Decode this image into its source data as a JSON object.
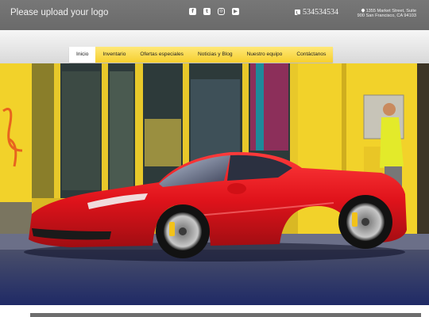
{
  "header": {
    "logo_text": "Please upload your logo",
    "social": [
      {
        "name": "facebook-icon",
        "glyph": "f"
      },
      {
        "name": "twitter-icon",
        "glyph": "t"
      },
      {
        "name": "instagram-icon",
        "glyph": "◎"
      },
      {
        "name": "youtube-icon",
        "glyph": "▶"
      }
    ],
    "phone": "534534534",
    "address_line1": "1355 Market Street, Suite",
    "address_line2": "900 San Francisco, CA 94103"
  },
  "nav": {
    "items": [
      "Inicio",
      "Inventario",
      "Ofertas especiales",
      "Noticias y Blog",
      "Nuestro equipo",
      "Contáctanos"
    ],
    "active_index": 0
  },
  "hero": {
    "image": "red sports car parked in front of yellow storefront, man in yellow shirt on sidewalk"
  },
  "colors": {
    "topbar": "#707070",
    "nav_accent": "#f7d23a",
    "car_red": "#e0131b",
    "wall_yellow": "#f2d22a"
  }
}
